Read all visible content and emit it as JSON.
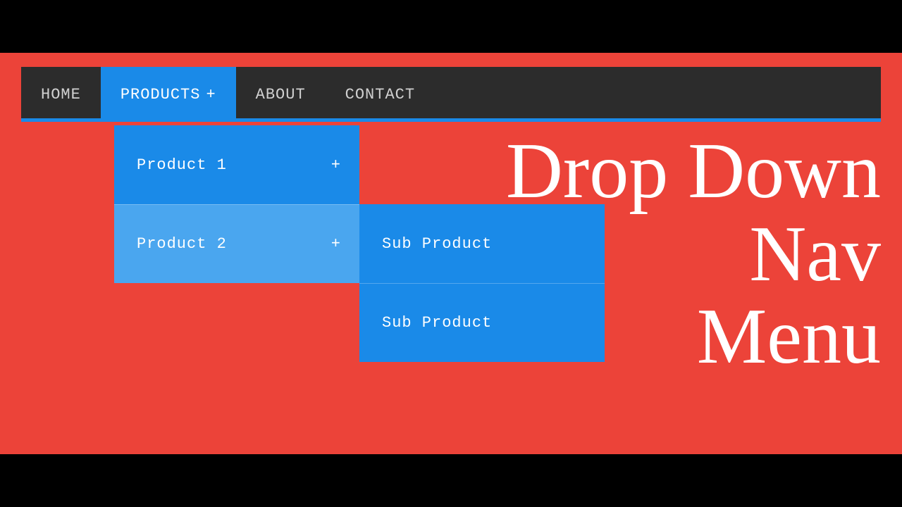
{
  "nav": {
    "items": [
      {
        "label": "HOME"
      },
      {
        "label": "PRODUCTS",
        "expand": "+"
      },
      {
        "label": "ABOUT"
      },
      {
        "label": "CONTACT"
      }
    ]
  },
  "dropdown": {
    "items": [
      {
        "label": "Product 1",
        "expand": "+"
      },
      {
        "label": "Product 2",
        "expand": "+"
      }
    ]
  },
  "flyout": {
    "items": [
      {
        "label": "Sub Product"
      },
      {
        "label": "Sub Product"
      }
    ]
  },
  "headline": {
    "line1": "Drop Down",
    "line2": "Nav",
    "line3": "Menu"
  }
}
